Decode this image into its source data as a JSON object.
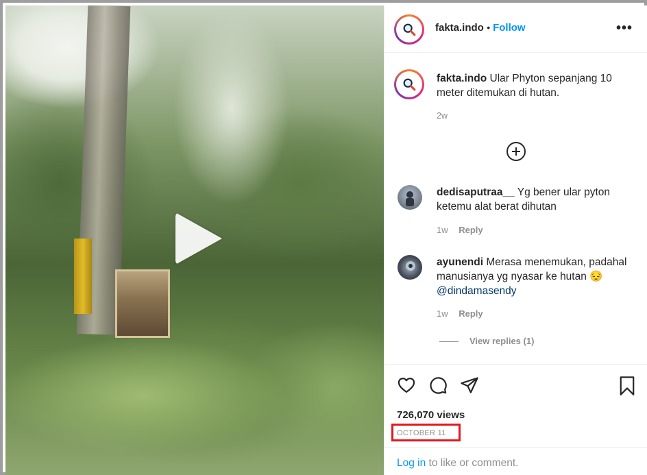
{
  "post": {
    "username": "fakta.indo",
    "follow_label": "Follow",
    "more_label": "•••",
    "caption": "Ular Phyton sepanjang 10 meter ditemukan di hutan.",
    "caption_time": "2w",
    "views": "726,070 views",
    "date": "OCTOBER 11"
  },
  "comments": [
    {
      "username": "dedisaputraa__",
      "text": "Yg bener ular pyton ketemu alat berat dihutan",
      "time": "1w",
      "reply_label": "Reply"
    },
    {
      "username": "ayunendi",
      "text": "Merasa menemukan, padahal manusianya yg nyasar ke hutan 😔",
      "mention": "@dindamasendy",
      "time": "1w",
      "reply_label": "Reply",
      "view_replies": "View replies (1)"
    }
  ],
  "footer": {
    "login_link": "Log in",
    "login_rest": " to like or comment."
  },
  "icons": {
    "like": "heart-icon",
    "comment": "comment-icon",
    "share": "paper-plane-icon",
    "save": "bookmark-icon",
    "play": "play-icon",
    "load_more": "plus-circle-icon"
  },
  "colors": {
    "link_blue": "#0095f6",
    "highlight_red": "#e0191f",
    "meta_gray": "#8e8e8e"
  }
}
